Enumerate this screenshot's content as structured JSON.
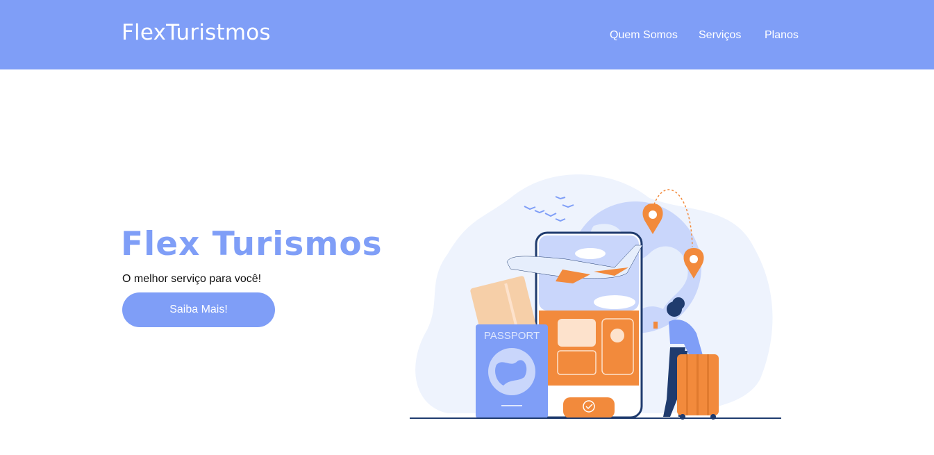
{
  "header": {
    "logo": "FlexTuristmos",
    "nav": [
      {
        "label": "Quem Somos"
      },
      {
        "label": "Serviços"
      },
      {
        "label": "Planos"
      }
    ]
  },
  "hero": {
    "title": "Flex Turismos",
    "subtitle": "O melhor serviço para você!",
    "cta_label": "Saiba Mais!"
  },
  "illustration": {
    "passport_text": "PASSPORT"
  },
  "colors": {
    "brand": "#7f9ef7",
    "accent": "#f28a3c",
    "dark_blue": "#1f3b6e"
  }
}
